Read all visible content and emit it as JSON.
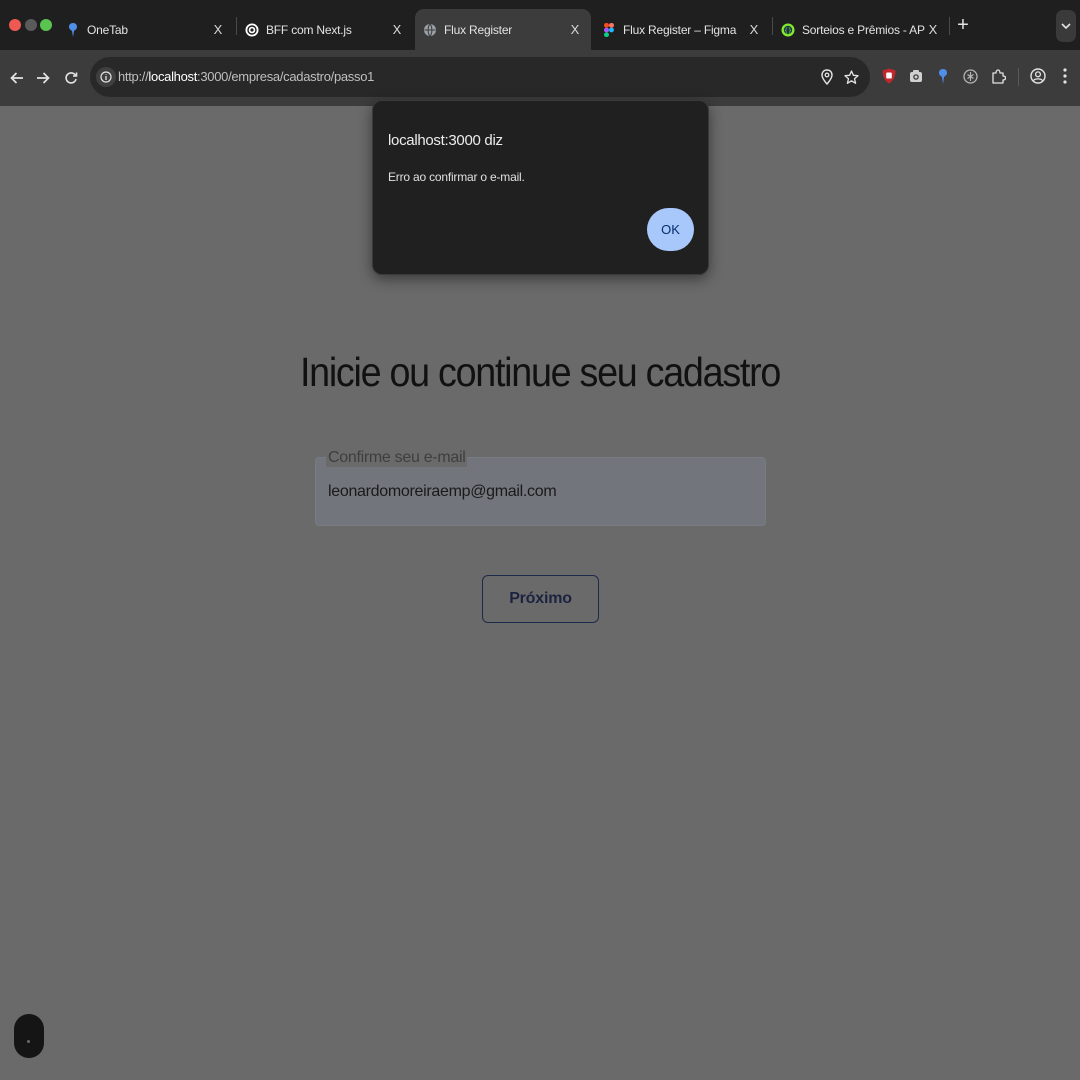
{
  "browser": {
    "tabs": [
      {
        "title": "OneTab",
        "favicon": "pin-icon",
        "active": false
      },
      {
        "title": "BFF com Next.js",
        "favicon": "openai-icon",
        "active": false
      },
      {
        "title": "Flux Register",
        "favicon": "globe-icon",
        "active": true
      },
      {
        "title": "Flux Register – Figma",
        "favicon": "figma-icon",
        "active": false
      },
      {
        "title": "Sorteios e Prêmios - API Docs",
        "favicon": "swagger-icon",
        "active": false
      }
    ],
    "close_glyph": "X",
    "new_tab_glyph": "+",
    "address": {
      "scheme": "http://",
      "host": "localhost",
      "path": ":3000/empresa/cadastro/passo1"
    },
    "icons": {
      "back": "back-arrow-icon",
      "forward": "forward-arrow-icon",
      "reload": "reload-icon",
      "site_info": "info-icon",
      "location": "location-icon",
      "bookmark": "star-icon",
      "extensions": [
        "ublock-icon",
        "camera-icon",
        "onetab-icon",
        "extension-icon",
        "puzzle-icon"
      ],
      "profile": "profile-icon",
      "menu": "kebab-menu-icon"
    }
  },
  "page": {
    "title": "Inicie ou continue seu cadastro",
    "email_field": {
      "label": "Confirme seu e-mail",
      "value": "leonardomoreiraemp@gmail.com"
    },
    "next_button": "Próximo"
  },
  "dialog": {
    "origin": "localhost:3000 diz",
    "message": "Erro ao confirmar o e-mail.",
    "ok_label": "OK"
  },
  "colors": {
    "overlay": "#6a6a6a",
    "dialog_bg": "#202020",
    "ok_button": "#a8c7fa",
    "tab_strip": "#1f1f1f",
    "toolbar": "#3c3c3c"
  }
}
